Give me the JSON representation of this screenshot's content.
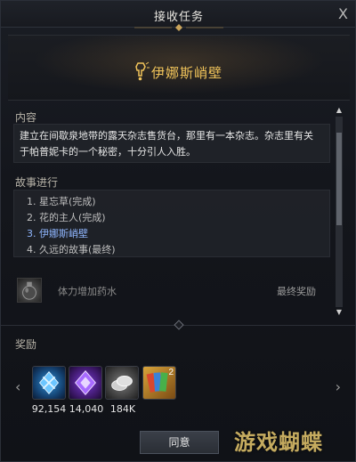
{
  "window": {
    "title": "接收任务",
    "close_symbol": "X"
  },
  "quest": {
    "name": "伊娜斯峭壁"
  },
  "content": {
    "label": "内容",
    "text_line1": "建立在间歇泉地带的露天杂志售货台，那里有一本杂志。杂志里有关",
    "text_line2": "于帕普妮卡的一个秘密，十分引人入胜。"
  },
  "story": {
    "label": "故事进行",
    "items": [
      {
        "text": "1. 星忘草(完成)",
        "active": false
      },
      {
        "text": "2. 花的主人(完成)",
        "active": false
      },
      {
        "text": "3. 伊娜斯峭壁",
        "active": true
      },
      {
        "text": "4. 久远的故事(最终)",
        "active": false
      }
    ]
  },
  "final_reward_row": {
    "item_name": "体力增加药水",
    "tag": "最终奖励",
    "icon": "potion-icon"
  },
  "rewards": {
    "label": "奖励",
    "items": [
      {
        "icon": "blue-crystal-icon",
        "count": "92,154",
        "color": "#2e8fd8"
      },
      {
        "icon": "purple-crystal-icon",
        "count": "14,040",
        "color": "#7a3bd6"
      },
      {
        "icon": "silver-coins-icon",
        "count": "184K",
        "color": "#bdbdbd"
      },
      {
        "icon": "card-pack-icon",
        "count": "",
        "badge": "2",
        "color": "#d9a43a"
      }
    ]
  },
  "accept_button": {
    "label": "同意"
  },
  "watermark": {
    "text": "游戏蝴蝶"
  },
  "colors": {
    "quest_title": "#f0c35a",
    "active_story": "#8fb6ff",
    "background": "#14161c"
  }
}
